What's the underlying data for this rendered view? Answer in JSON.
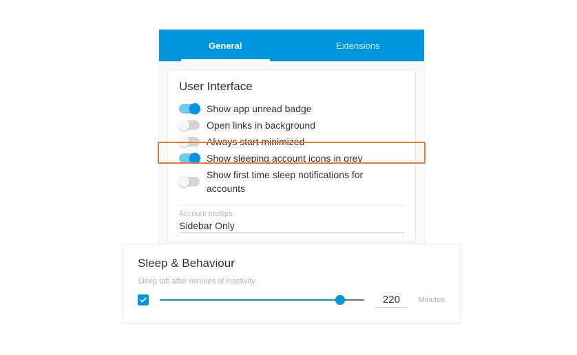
{
  "tabs": {
    "general": "General",
    "extensions": "Extensions"
  },
  "ui_section": {
    "title": "User Interface",
    "options": [
      {
        "label": "Show app unread badge",
        "on": true
      },
      {
        "label": "Open links in background",
        "on": false
      },
      {
        "label": "Always start minimized",
        "on": false
      },
      {
        "label": "Show sleeping account icons in grey",
        "on": true
      },
      {
        "label": "Show first time sleep notifications for accounts",
        "on": false
      }
    ],
    "tooltip_field_label": "Account tooltips",
    "tooltip_value": "Sidebar Only"
  },
  "sleep_section": {
    "title": "Sleep & Behaviour",
    "label": "Sleep tab after minutes of inactivity",
    "checked": true,
    "value": "220",
    "unit": "Minutes",
    "percent": 88
  }
}
